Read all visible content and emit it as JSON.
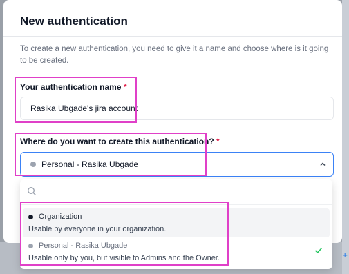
{
  "modal": {
    "title": "New authentication",
    "description": "To create a new authentication, you need to give it a name and choose where is it going to be created."
  },
  "name_field": {
    "label": "Your authentication name",
    "required_mark": "*",
    "value": "Rasika Ubgade's jira account"
  },
  "location_field": {
    "label": "Where do you want to create this authentication?",
    "required_mark": "*",
    "selected_value": "Personal - Rasika Ubgade"
  },
  "dropdown": {
    "search_placeholder": "",
    "options": [
      {
        "label": "Organization",
        "description": "Usable by everyone in your organization.",
        "checked": false
      },
      {
        "label": "Personal - Rasika Ubgade",
        "description": "Usable only by you, but visible to Admins and the Owner.",
        "checked": true
      }
    ]
  },
  "backdrop": {
    "plus_label": "+"
  },
  "colors": {
    "accent": "#3b82f6",
    "highlight": "#e040c8",
    "required": "#e11d48",
    "check": "#22c55e"
  }
}
